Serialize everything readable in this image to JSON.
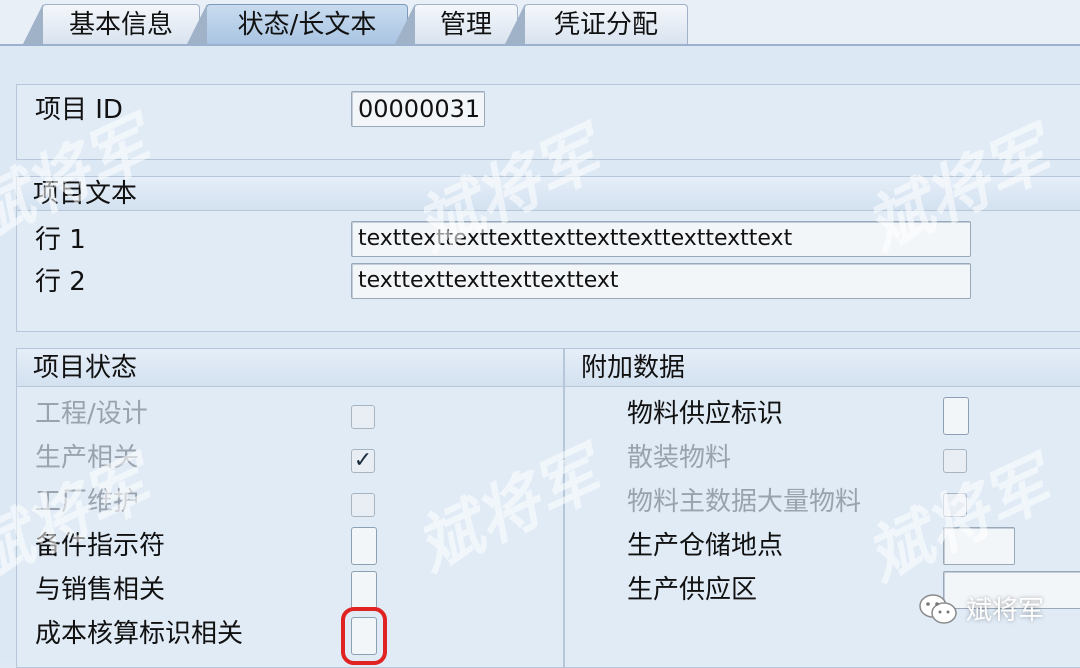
{
  "tabs": [
    {
      "label": "基本信息",
      "active": false
    },
    {
      "label": "状态/长文本",
      "active": true
    },
    {
      "label": "管理",
      "active": false
    },
    {
      "label": "凭证分配",
      "active": false
    }
  ],
  "header": {
    "item_id_label": "项目 ID",
    "item_id_value": "00000031"
  },
  "item_text": {
    "title": "项目文本",
    "line1_label": "行 1",
    "line1_value": "texttexttexttexttexttexttexttexttexttext",
    "line2_label": "行 2",
    "line2_value": "texttexttexttexttexttext"
  },
  "item_status": {
    "title": "项目状态",
    "rows": [
      {
        "label": "工程/设计",
        "checked": false,
        "enabled": false
      },
      {
        "label": "生产相关",
        "checked": true,
        "enabled": false
      },
      {
        "label": "工厂维护",
        "checked": false,
        "enabled": false
      },
      {
        "label": "备件指示符",
        "checked": false,
        "enabled": true
      },
      {
        "label": "与销售相关",
        "checked": false,
        "enabled": true
      },
      {
        "label": "成本核算标识相关",
        "checked": false,
        "enabled": true,
        "highlighted": true
      }
    ]
  },
  "additional_data": {
    "title": "附加数据",
    "rows": [
      {
        "label": "物料供应标识",
        "value": "",
        "enabled": true
      },
      {
        "label": "散装物料",
        "checked": false,
        "enabled": false
      },
      {
        "label": "物料主数据大量物料",
        "checked": false,
        "enabled": false
      },
      {
        "label": "生产仓储地点",
        "value": "",
        "enabled": true
      },
      {
        "label": "生产供应区",
        "value": "",
        "enabled": true
      }
    ]
  },
  "watermark": {
    "text": "斌将军",
    "badge_text": "斌将军",
    "badge_icon": "wechat-icon"
  },
  "colors": {
    "highlight": "#e02222",
    "tab_active": "#b4cce6",
    "background": "#dce8f4"
  }
}
